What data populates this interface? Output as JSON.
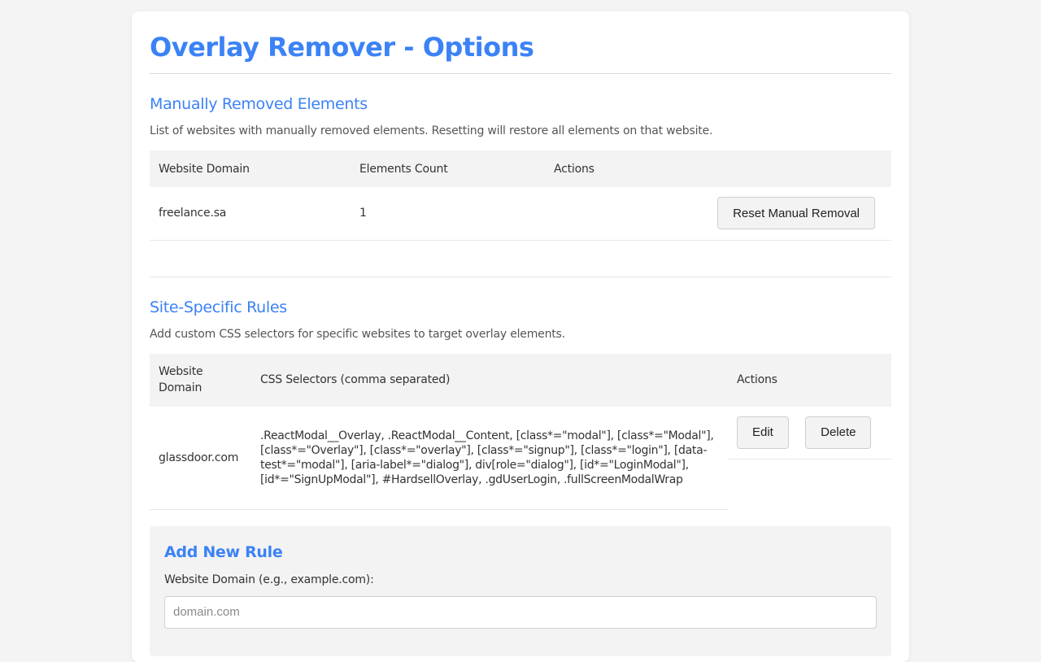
{
  "page": {
    "title": "Overlay Remover - Options"
  },
  "manual": {
    "heading": "Manually Removed Elements",
    "description": "List of websites with manually removed elements. Resetting will restore all elements on that website.",
    "columns": [
      "Website Domain",
      "Elements Count",
      "Actions"
    ],
    "rows": [
      {
        "domain": "freelance.sa",
        "count": "1",
        "action_label": "Reset Manual Removal"
      }
    ]
  },
  "rules": {
    "heading": "Site-Specific Rules",
    "description": "Add custom CSS selectors for specific websites to target overlay elements.",
    "columns": [
      "Website Domain",
      "CSS Selectors (comma separated)",
      "Actions"
    ],
    "rows": [
      {
        "domain": "glassdoor.com",
        "selectors": ".ReactModal__Overlay, .ReactModal__Content, [class*=\"modal\"], [class*=\"Modal\"], [class*=\"Overlay\"], [class*=\"overlay\"], [class*=\"signup\"], [class*=\"login\"], [data-test*=\"modal\"], [aria-label*=\"dialog\"], div[role=\"dialog\"], [id*=\"LoginModal\"], [id*=\"SignUpModal\"], #HardsellOverlay, .gdUserLogin, .fullScreenModalWrap",
        "edit_label": "Edit",
        "delete_label": "Delete"
      }
    ]
  },
  "add_rule": {
    "heading": "Add New Rule",
    "domain_label": "Website Domain (e.g., example.com):",
    "domain_placeholder": "domain.com",
    "domain_value": ""
  },
  "colors": {
    "accent": "#3b82f6",
    "background": "#f4f4f4",
    "card": "#ffffff"
  }
}
